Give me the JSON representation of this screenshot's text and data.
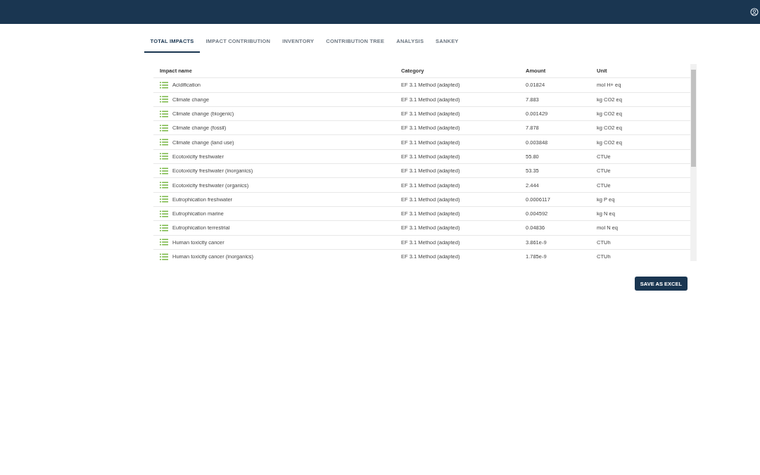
{
  "tabs": [
    {
      "label": "TOTAL IMPACTS",
      "selected": true
    },
    {
      "label": "IMPACT CONTRIBUTION",
      "selected": false
    },
    {
      "label": "INVENTORY",
      "selected": false
    },
    {
      "label": "CONTRIBUTION TREE",
      "selected": false
    },
    {
      "label": "ANALYSIS",
      "selected": false
    },
    {
      "label": "SANKEY",
      "selected": false
    }
  ],
  "table": {
    "columns": [
      "Impact name",
      "Category",
      "Amount",
      "Unit"
    ],
    "rows": [
      [
        "Acidification",
        "EF 3.1 Method (adapted)",
        "0.01824",
        "mol H+ eq"
      ],
      [
        "Climate change",
        "EF 3.1 Method (adapted)",
        "7.883",
        "kg CO2 eq"
      ],
      [
        "Climate change (biogenic)",
        "EF 3.1 Method (adapted)",
        "0.001429",
        "kg CO2 eq"
      ],
      [
        "Climate change (fossil)",
        "EF 3.1 Method (adapted)",
        "7.878",
        "kg CO2 eq"
      ],
      [
        "Climate change (land use)",
        "EF 3.1 Method (adapted)",
        "0.003848",
        "kg CO2 eq"
      ],
      [
        "Ecotoxicity freshwater",
        "EF 3.1 Method (adapted)",
        "55.80",
        "CTUe"
      ],
      [
        "Ecotoxicity freshwater (inorganics)",
        "EF 3.1 Method (adapted)",
        "53.35",
        "CTUe"
      ],
      [
        "Ecotoxicity freshwater (organics)",
        "EF 3.1 Method (adapted)",
        "2.444",
        "CTUe"
      ],
      [
        "Eutrophication freshwater",
        "EF 3.1 Method (adapted)",
        "0.0006117",
        "kg P eq"
      ],
      [
        "Eutrophication marine",
        "EF 3.1 Method (adapted)",
        "0.004592",
        "kg N eq"
      ],
      [
        "Eutrophication terrestrial",
        "EF 3.1 Method (adapted)",
        "0.04836",
        "mol N eq"
      ],
      [
        "Human toxicity cancer",
        "EF 3.1 Method (adapted)",
        "3.861e-9",
        "CTUh"
      ],
      [
        "Human toxicity cancer (inorganics)",
        "EF 3.1 Method (adapted)",
        "1.785e-9",
        "CTUh"
      ]
    ]
  },
  "save_button": "SAVE AS EXCEL"
}
